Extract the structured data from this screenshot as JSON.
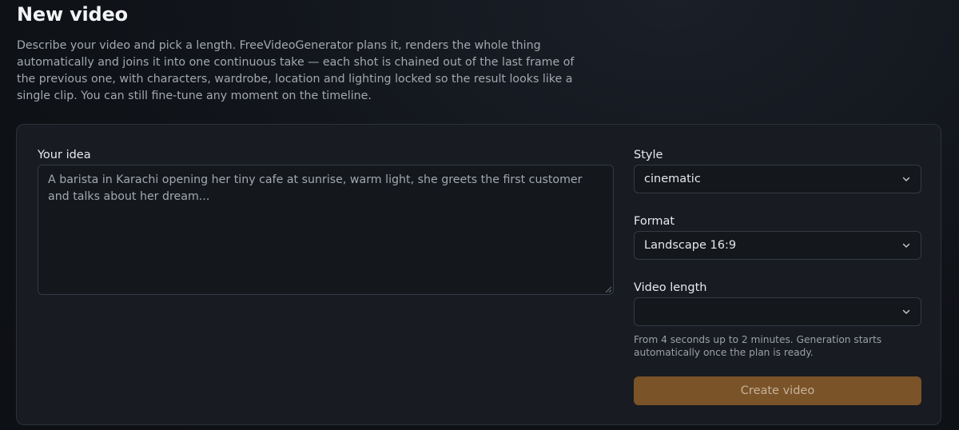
{
  "header": {
    "title": "New video",
    "description": "Describe your video and pick a length. FreeVideoGenerator plans it, renders the whole thing automatically and joins it into one continuous take — each shot is chained out of the last frame of the previous one, with characters, wardrobe, location and lighting locked so the result looks like a single clip. You can still fine-tune any moment on the timeline."
  },
  "form": {
    "idea": {
      "label": "Your idea",
      "placeholder": "A barista in Karachi opening her tiny cafe at sunrise, warm light, she greets the first customer and talks about her dream..."
    },
    "style": {
      "label": "Style",
      "value": "cinematic"
    },
    "format": {
      "label": "Format",
      "value": "Landscape 16:9"
    },
    "length": {
      "label": "Video length",
      "value": "",
      "help": "From 4 seconds up to 2 minutes. Generation starts automatically once the plan is ready."
    },
    "submit_label": "Create video"
  },
  "colors": {
    "accent": "#7a5328",
    "background": "#0f1217",
    "card": "#181b21"
  }
}
